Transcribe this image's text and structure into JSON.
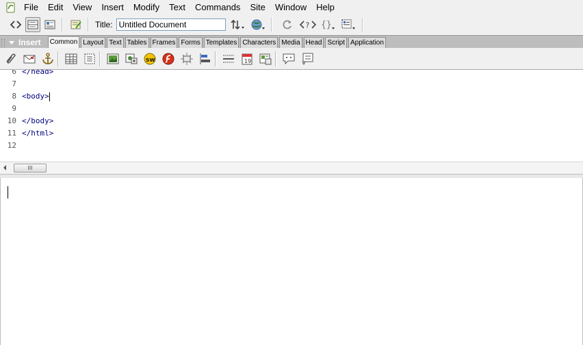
{
  "menubar": {
    "items": [
      "File",
      "Edit",
      "View",
      "Insert",
      "Modify",
      "Text",
      "Commands",
      "Site",
      "Window",
      "Help"
    ]
  },
  "doc_toolbar": {
    "title_label": "Title:",
    "title_value": "Untitled Document"
  },
  "insert_panel": {
    "title": "Insert",
    "tabs": [
      "Common",
      "Layout",
      "Text",
      "Tables",
      "Frames",
      "Forms",
      "Templates",
      "Characters",
      "Media",
      "Head",
      "Script",
      "Application"
    ],
    "active_tab": "Common"
  },
  "code": {
    "lines": [
      {
        "num": "6",
        "text": "</head>"
      },
      {
        "num": "7",
        "text": ""
      },
      {
        "num": "8",
        "text": "<body>"
      },
      {
        "num": "9",
        "text": ""
      },
      {
        "num": "10",
        "text": "</body>"
      },
      {
        "num": "11",
        "text": "</html>"
      },
      {
        "num": "12",
        "text": ""
      }
    ]
  },
  "scrollbar": {
    "thumb_glyph": "III"
  },
  "colors": {
    "code_text": "#000080",
    "panel_header": "#bdbdbd"
  }
}
